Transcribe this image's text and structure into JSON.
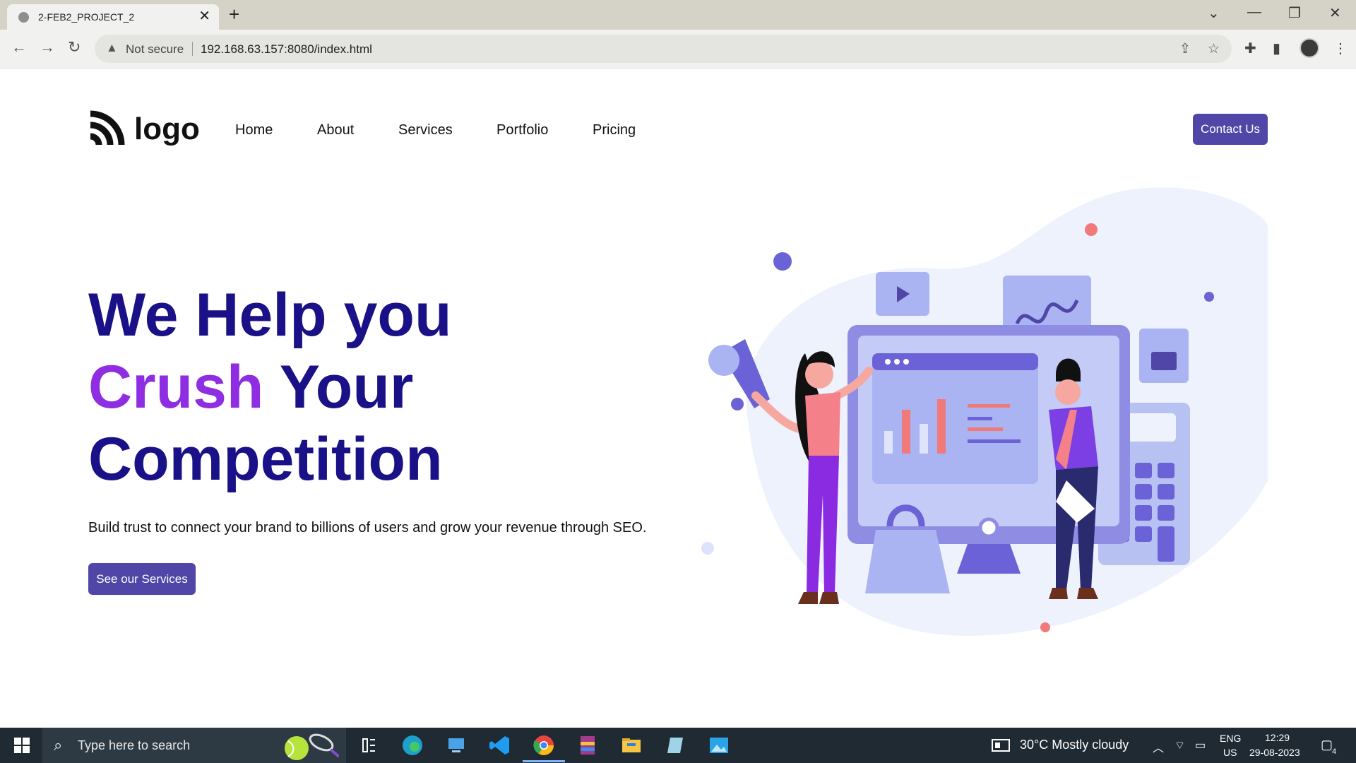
{
  "browser": {
    "tab_title": "2-FEB2_PROJECT_2",
    "security_label": "Not secure",
    "url": "192.168.63.157:8080/index.html"
  },
  "page": {
    "logo_text": "logo",
    "nav": [
      "Home",
      "About",
      "Services",
      "Portfolio",
      "Pricing"
    ],
    "contact_button": "Contact Us",
    "hero": {
      "line1": "We Help you",
      "highlight": "Crush",
      "line2_rest": " Your",
      "line3": "Competition"
    },
    "subtext": "Build trust to connect your brand to billions of users and grow your revenue through SEO.",
    "cta_button": "See our Services",
    "colors": {
      "primary": "#1a1087",
      "accent": "#8e2de2",
      "button": "#5046a8"
    }
  },
  "taskbar": {
    "search_placeholder": "Type here to search",
    "weather": "30°C  Mostly cloudy",
    "lang_top": "ENG",
    "lang_bottom": "US",
    "time": "12:29",
    "date": "29-08-2023",
    "notification_count": "4"
  }
}
